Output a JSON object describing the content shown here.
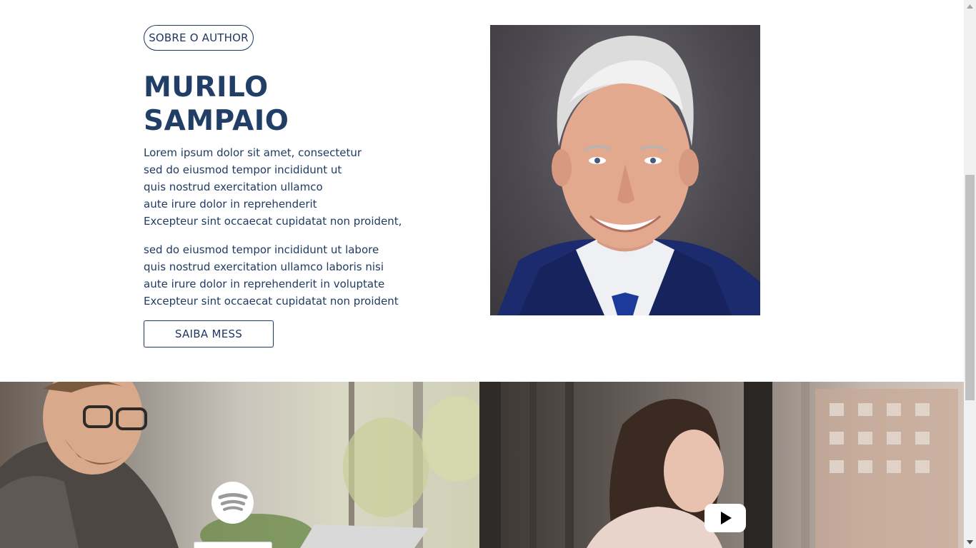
{
  "author": {
    "badge_label": "SOBRE O AUTHOR",
    "name_line1": "MURILO",
    "name_line2": "SAMPAIO",
    "bio_paragraph1": [
      "Lorem ipsum dolor sit amet, consectetur",
      "sed do eiusmod tempor incididunt ut",
      "quis nostrud exercitation ullamco",
      "aute irure dolor in reprehenderit",
      "Excepteur sint occaecat cupidatat non proident,"
    ],
    "bio_paragraph2": [
      "sed do eiusmod tempor incididunt ut labore",
      "quis nostrud exercitation ullamco laboris nisi",
      "aute irure dolor in reprehenderit in voluptate",
      "Excepteur sint occaecat cupidatat non proident"
    ],
    "cta_label": "SAIBA MESS",
    "portrait_image": "author-portrait"
  },
  "panels": {
    "left": {
      "background_image": "man-with-laptop-photo",
      "icon": "spotify-icon"
    },
    "right": {
      "background_image": "woman-at-window-photo",
      "icon": "youtube-icon"
    }
  },
  "colors": {
    "primary": "#213e67",
    "text": "#203b63",
    "youtube_play": "#000000"
  }
}
